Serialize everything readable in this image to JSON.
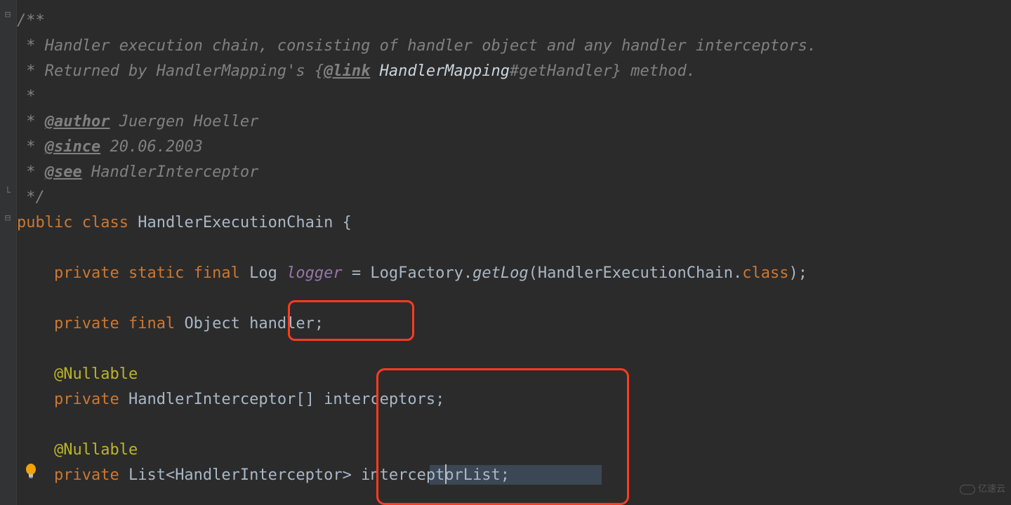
{
  "code": {
    "doc": {
      "open": "/**",
      "line1_prefix": " * ",
      "line1": "Handler execution chain, consisting of handler object and any handler interceptors.",
      "line2_prefix": " * ",
      "line2a": "Returned by HandlerMapping's {",
      "link_tag": "@link",
      "link_text": " HandlerMapping",
      "line2b": "#getHandler} method.",
      "blank": " *",
      "author_tag": "@author",
      "author_val": " Juergen Hoeller",
      "since_tag": "@since",
      "since_val": " 20.06.2003",
      "see_tag": "@see",
      "see_val": " HandlerInterceptor",
      "close": " */"
    },
    "class": {
      "public": "public",
      "class_kw": "class",
      "name": "HandlerExecutionChain",
      "open_brace": "{"
    },
    "logger": {
      "private": "private",
      "static": "static",
      "final": "final",
      "type": "Log",
      "name": "logger",
      "eq": " = ",
      "factory": "LogFactory",
      "dot": ".",
      "method": "getLog",
      "open": "(",
      "arg": "HandlerExecutionChain",
      "dotclass": ".",
      "class_kw": "class",
      "close": ");"
    },
    "handler": {
      "private": "private",
      "final": "final",
      "type": "Object",
      "name": "handler",
      "semi": ";"
    },
    "nullable": "@Nullable",
    "interceptors": {
      "private": "private",
      "type": "HandlerInterceptor",
      "arr": "[]",
      "name": "interceptors",
      "semi": ";"
    },
    "interceptorList": {
      "private": "private",
      "type_outer": "List",
      "lt": "<",
      "type_inner": "HandlerInterceptor",
      "gt": ">",
      "name": "interceptorList",
      "semi": ";"
    }
  },
  "watermark": "亿速云"
}
